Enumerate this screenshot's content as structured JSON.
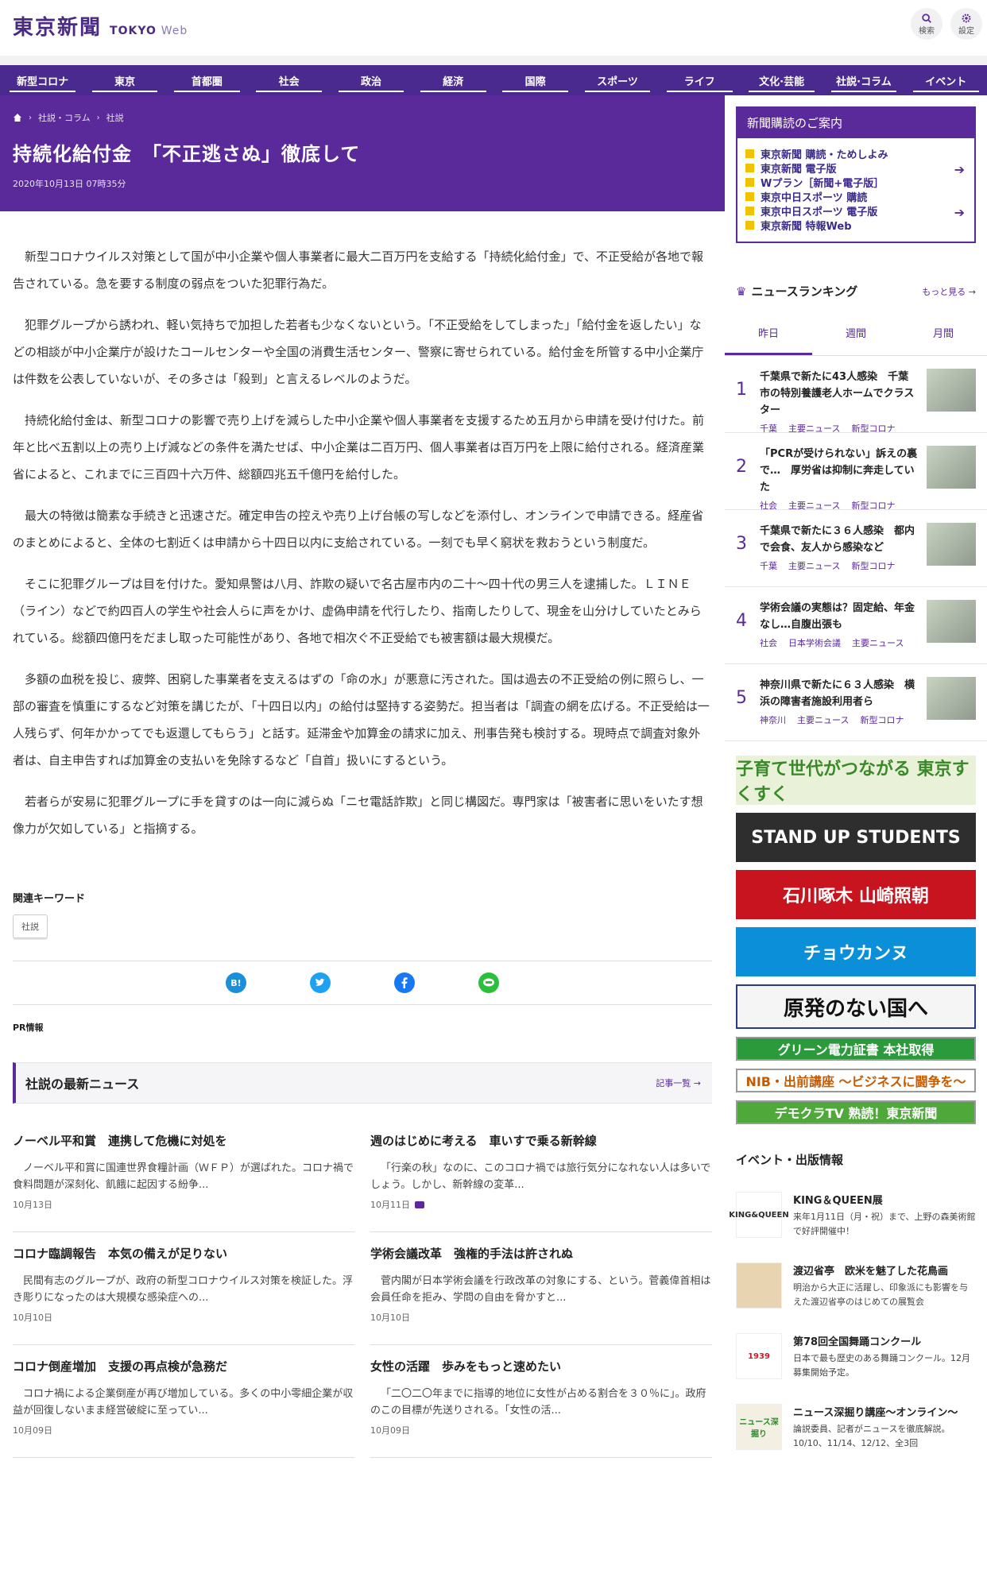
{
  "header": {
    "logo_jp": "東京新聞",
    "logo_en": "TOKYO",
    "logo_web": "Web",
    "search_label": "検索",
    "settings_label": "設定"
  },
  "nav": [
    "新型コロナ",
    "東京",
    "首都圏",
    "社会",
    "政治",
    "経済",
    "国際",
    "スポーツ",
    "ライフ",
    "文化·芸能",
    "社説·コラム",
    "イベント"
  ],
  "breadcrumb": {
    "item1": "社説・コラム",
    "item2": "社説"
  },
  "article": {
    "title": "持続化給付金　「不正逃さぬ」徹底して",
    "date": "2020年10月13日 07時35分",
    "paragraphs": [
      "新型コロナウイルス対策として国が中小企業や個人事業者に最大二百万円を支給する「持続化給付金」で、不正受給が各地で報告されている。急を要する制度の弱点をついた犯罪行為だ。",
      "犯罪グループから誘われ、軽い気持ちで加担した若者も少なくないという。「不正受給をしてしまった」「給付金を返したい」などの相談が中小企業庁が設けたコールセンターや全国の消費生活センター、警察に寄せられている。給付金を所管する中小企業庁は件数を公表していないが、その多さは「殺到」と言えるレベルのようだ。",
      "持続化給付金は、新型コロナの影響で売り上げを減らした中小企業や個人事業者を支援するため五月から申請を受け付けた。前年と比べ五割以上の売り上げ減などの条件を満たせば、中小企業は二百万円、個人事業者は百万円を上限に給付される。経済産業省によると、これまでに三百四十六万件、総額四兆五千億円を給付した。",
      "最大の特徴は簡素な手続きと迅速さだ。確定申告の控えや売り上げ台帳の写しなどを添付し、オンラインで申請できる。経産省のまとめによると、全体の七割近くは申請から十四日以内に支給されている。一刻でも早く窮状を救おうという制度だ。",
      "そこに犯罪グループは目を付けた。愛知県警は八月、詐欺の疑いで名古屋市内の二十〜四十代の男三人を逮捕した。ＬＩＮＥ（ライン）などで約四百人の学生や社会人らに声をかけ、虚偽申請を代行したり、指南したりして、現金を山分けしていたとみられている。総額四億円をだまし取った可能性があり、各地で相次ぐ不正受給でも被害額は最大規模だ。",
      "多額の血税を投じ、疲弊、困窮した事業者を支えるはずの「命の水」が悪意に汚された。国は過去の不正受給の例に照らし、一部の審査を慎重にするなど対策を講じたが、「十四日以内」の給付は堅持する姿勢だ。担当者は「調査の網を広げる。不正受給は一人残らず、何年かかってでも返還してもらう」と話す。延滞金や加算金の請求に加え、刑事告発も検討する。現時点で調査対象外者は、自主申告すれば加算金の支払いを免除するなど「自首」扱いにするという。",
      "若者らが安易に犯罪グループに手を貸すのは一向に減らぬ「ニセ電話詐欺」と同じ構図だ。専門家は「被害者に思いをいたす想像力が欠如している」と指摘する。"
    ]
  },
  "keywords": {
    "title": "関連キーワード",
    "chip": "社説"
  },
  "share": {
    "hatena": "B!"
  },
  "pr_label": "PR情報",
  "latest": {
    "title": "社説の最新ニュース",
    "more": "記事一覧",
    "items": [
      {
        "title": "ノーベル平和賞　連携して危機に対処を",
        "text": "ノーベル平和賞に国連世界食糧計画（ＷＦＰ）が選ばれた。コロナ禍で食料問題が深刻化、飢餓に起因する紛争...",
        "date": "10月13日"
      },
      {
        "title": "週のはじめに考える　車いすで乗る新幹線",
        "text": "「行楽の秋」なのに、このコロナ禍では旅行気分になれない人は多いでしょう。しかし、新幹線の変革...",
        "date": "10月11日"
      },
      {
        "title": "コロナ臨調報告　本気の備えが足りない",
        "text": "民間有志のグループが、政府の新型コロナウイルス対策を検証した。浮き彫りになったのは大規模な感染症への...",
        "date": "10月10日"
      },
      {
        "title": "学術会議改革　強権的手法は許されぬ",
        "text": "菅内閣が日本学術会議を行政改革の対象にする、という。菅義偉首相は会員任命を拒み、学問の自由を脅かすと...",
        "date": "10月10日"
      },
      {
        "title": "コロナ倒産増加　支援の再点検が急務だ",
        "text": "コロナ禍による企業倒産が再び増加している。多くの中小零細企業が収益が回復しないまま経営破綻に至ってい...",
        "date": "10月09日"
      },
      {
        "title": "女性の活躍　歩みをもっと速めたい",
        "text": "「二〇二〇年までに指導的地位に女性が占める割合を３０％に」。政府のこの目標が先送りされる。「女性の活...",
        "date": "10月09日"
      }
    ]
  },
  "subscription": {
    "title": "新聞購読のご案内",
    "items": [
      "東京新聞 購読・ためしよみ",
      "東京新聞 電子版",
      "Wプラン［新聞+電子版］",
      "東京中日スポーツ 購読",
      "東京中日スポーツ 電子版",
      "東京新聞 特報Web"
    ]
  },
  "ranking": {
    "title": "ニュースランキング",
    "more": "もっと見る",
    "tabs": [
      "昨日",
      "週間",
      "月間"
    ],
    "items": [
      {
        "num": "1",
        "title": "千葉県で新たに43人感染　千葉市の特別養護老人ホームでクラスター",
        "tags": [
          "千葉",
          "主要ニュース",
          "新型コロナ"
        ]
      },
      {
        "num": "2",
        "title": "「PCRが受けられない」訴えの裏で…　厚労省は抑制に奔走していた",
        "tags": [
          "社会",
          "主要ニュース",
          "新型コロナ"
        ]
      },
      {
        "num": "3",
        "title": "千葉県で新たに３６人感染　都内で会食、友人から感染など",
        "tags": [
          "千葉",
          "主要ニュース",
          "新型コロナ"
        ]
      },
      {
        "num": "4",
        "title": "学術会議の実態は？固定給、年金なし…自腹出張も",
        "tags": [
          "社会",
          "日本学術会議",
          "主要ニュース"
        ]
      },
      {
        "num": "5",
        "title": "神奈川県で新たに６３人感染　横浜の障害者施設利用者ら",
        "tags": [
          "神奈川",
          "主要ニュース",
          "新型コロナ"
        ]
      }
    ]
  },
  "banners": [
    {
      "text": "子育て世代がつながる 東京すくすく",
      "bg": "#e9f2d8",
      "color": "#3a8a2a"
    },
    {
      "text": "STAND UP STUDENTS",
      "bg": "#2e2e2e",
      "color": "#ffffff"
    },
    {
      "text": "石川啄木 山崎照朝",
      "bg": "#c8141e",
      "color": "#ffffff"
    },
    {
      "text": "チョウカンヌ",
      "bg": "#0b8fd8",
      "color": "#ffffff"
    },
    {
      "text": "原発のない国へ",
      "bg": "#f5f5f5",
      "color": "#111111"
    },
    {
      "text": "グリーン電力証書 本社取得",
      "bg": "#2a9a3a",
      "color": "#ffffff"
    },
    {
      "text": "NIB・出前講座 ～ビジネスに闘争を～",
      "bg": "#ffffff",
      "color": "#c85a00"
    },
    {
      "text": "デモクラTV 熟読！東京新聞",
      "bg": "#4ea83a",
      "color": "#ffffff"
    }
  ],
  "events": {
    "title": "イベント・出版情報",
    "items": [
      {
        "img": "KING&QUEEN",
        "title": "KING＆QUEEN展",
        "desc": "来年1月11日（月・祝）まで、上野の森美術館で好評開催中！"
      },
      {
        "img": "",
        "title": "渡辺省亭　欧米を魅了した花鳥画",
        "desc": "明治から大正に活躍し、印象派にも影響を与えた渡辺省亭のはじめての展覧会"
      },
      {
        "img": "1939",
        "title": "第78回全国舞踊コンクール",
        "desc": "日本で最も歴史のある舞踊コンクール。12月募集開始予定。"
      },
      {
        "img": "ニュース深掘り",
        "title": "ニュース深掘り講座～オンライン～",
        "desc": "論説委員、記者がニュースを徹底解説。10/10、11/14、12/12、全3回"
      }
    ]
  }
}
